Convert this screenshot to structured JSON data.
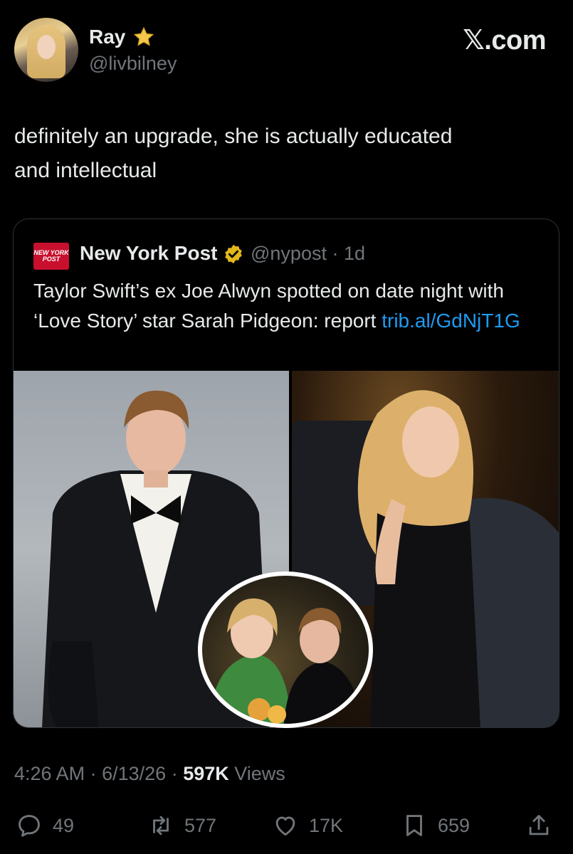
{
  "author": {
    "display_name": "Ray",
    "handle": "@livbilney",
    "badge_icon": "star-icon"
  },
  "brand": "𝕏.com",
  "tweet": {
    "text_line1": "definitely an upgrade, she is actually educated",
    "text_line2": "and intellectual"
  },
  "quote": {
    "logo_text": "NEW YORK POST",
    "name": "New York Post",
    "verified_icon": "gold-check-icon",
    "handle_time": "@nypost · 1d",
    "text": "Taylor Swift’s ex Joe Alwyn spotted on date night with ‘Love Story’ star Sarah Pidgeon: report ",
    "link": "trib.al/GdNjT1G"
  },
  "meta": {
    "time": "4:26 AM",
    "date": "6/13/26",
    "views_count": "597K",
    "views_label": "Views"
  },
  "actions": {
    "replies": "49",
    "reposts": "577",
    "likes": "17K",
    "bookmarks": "659"
  },
  "colors": {
    "background": "#000000",
    "text": "#e7e9ea",
    "muted": "#71767b",
    "link": "#1d9bf0",
    "nyp_red": "#c8102e",
    "gold": "#e2b719"
  }
}
